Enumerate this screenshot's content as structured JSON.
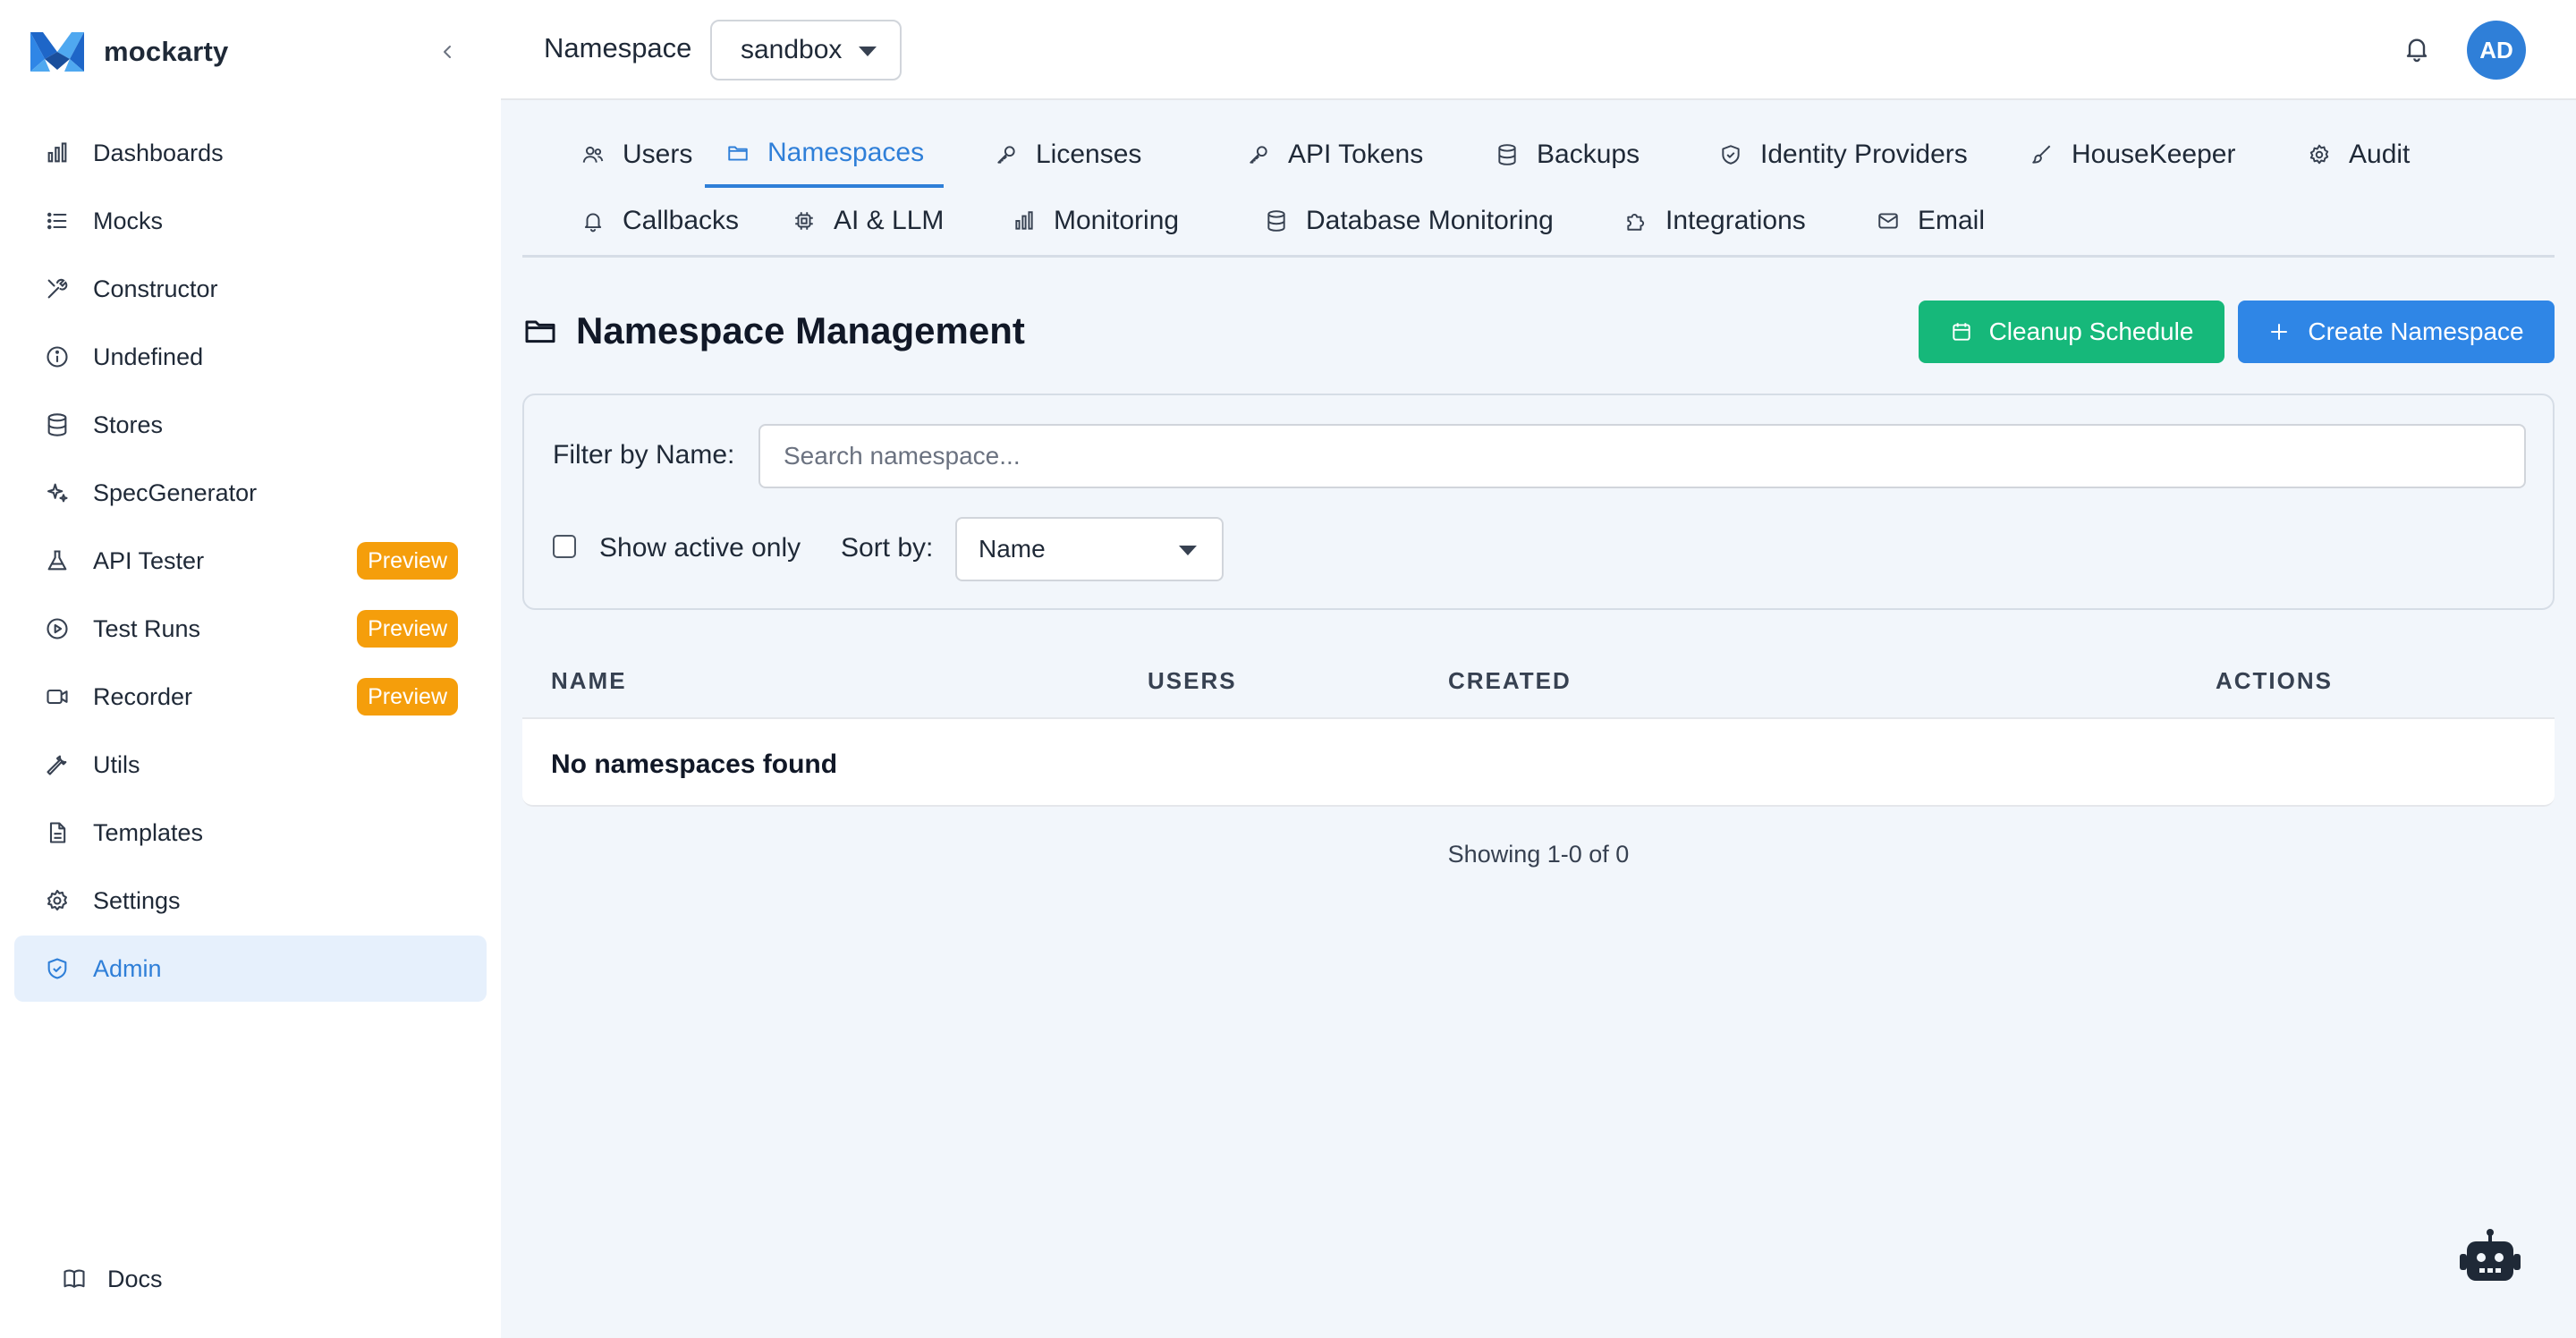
{
  "app": {
    "brand": "mockarty",
    "accent": "#2f7fd8"
  },
  "sidebar": {
    "items": [
      {
        "label": "Dashboards",
        "icon": "bar-chart-icon"
      },
      {
        "label": "Mocks",
        "icon": "list-icon"
      },
      {
        "label": "Constructor",
        "icon": "tools-icon"
      },
      {
        "label": "Undefined",
        "icon": "info-icon"
      },
      {
        "label": "Stores",
        "icon": "database-icon"
      },
      {
        "label": "SpecGenerator",
        "icon": "sparkles-icon"
      },
      {
        "label": "API Tester",
        "icon": "flask-icon",
        "badge": "Preview"
      },
      {
        "label": "Test Runs",
        "icon": "play-circle-icon",
        "badge": "Preview"
      },
      {
        "label": "Recorder",
        "icon": "video-icon",
        "badge": "Preview"
      },
      {
        "label": "Utils",
        "icon": "wrench-icon"
      },
      {
        "label": "Templates",
        "icon": "file-text-icon"
      },
      {
        "label": "Settings",
        "icon": "gear-icon"
      },
      {
        "label": "Admin",
        "icon": "shield-icon",
        "active": true
      }
    ],
    "docs": "Docs"
  },
  "topbar": {
    "namespace_label": "Namespace",
    "namespace_value": "sandbox",
    "avatar_initials": "AD"
  },
  "tabs": [
    {
      "label": "Users",
      "icon": "users-icon"
    },
    {
      "label": "Namespaces",
      "icon": "folder-icon",
      "active": true
    },
    {
      "label": "Licenses",
      "icon": "key-icon"
    },
    {
      "label": "API Tokens",
      "icon": "key-icon"
    },
    {
      "label": "Backups",
      "icon": "database-icon"
    },
    {
      "label": "Identity Providers",
      "icon": "shield-icon"
    },
    {
      "label": "HouseKeeper",
      "icon": "brush-icon"
    },
    {
      "label": "Audit",
      "icon": "gear-icon"
    },
    {
      "label": "Callbacks",
      "icon": "bell-icon"
    },
    {
      "label": "AI & LLM",
      "icon": "chip-icon"
    },
    {
      "label": "Monitoring",
      "icon": "bar-chart-icon"
    },
    {
      "label": "Database Monitoring",
      "icon": "database-icon"
    },
    {
      "label": "Integrations",
      "icon": "puzzle-icon"
    },
    {
      "label": "Email",
      "icon": "mail-icon"
    }
  ],
  "page": {
    "title": "Namespace Management",
    "cleanup_button": "Cleanup Schedule",
    "create_button": "Create Namespace",
    "button_colors": {
      "green": "#16b87a",
      "blue": "#2f86e6"
    }
  },
  "filters": {
    "filter_label": "Filter by Name:",
    "search_placeholder": "Search namespace...",
    "search_value": "",
    "show_active_label": "Show active only",
    "show_active_checked": false,
    "sort_label": "Sort by:",
    "sort_value": "Name"
  },
  "table": {
    "columns": [
      "NAME",
      "USERS",
      "CREATED",
      "ACTIONS"
    ],
    "rows": [],
    "empty_message": "No namespaces found",
    "pagination": "Showing 1-0 of 0"
  }
}
